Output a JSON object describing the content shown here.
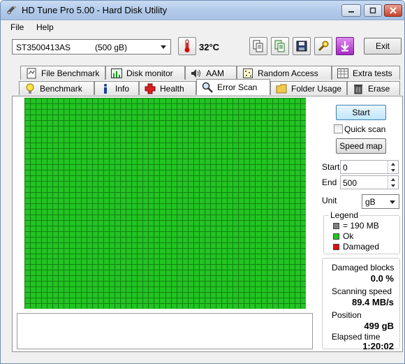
{
  "window": {
    "title": "HD Tune Pro 5.00 - Hard Disk Utility"
  },
  "menu": {
    "items": [
      "File",
      "Help"
    ]
  },
  "toolbar": {
    "drive_model": "ST3500413AS",
    "drive_capacity": "(500 gB)",
    "temperature": "32°C",
    "exit_label": "Exit",
    "icons": [
      "thermometer-icon",
      "copy-icon",
      "copy-all-icon",
      "save-icon",
      "options-icon",
      "download-icon"
    ]
  },
  "tabs": {
    "row1": [
      "File Benchmark",
      "Disk monitor",
      "AAM",
      "Random Access",
      "Extra tests"
    ],
    "row2": [
      "Benchmark",
      "Info",
      "Health",
      "Error Scan",
      "Folder Usage",
      "Erase"
    ],
    "active": "Error Scan"
  },
  "scan": {
    "grid_columns": 50,
    "grid_rows": 38,
    "block_status": "ok"
  },
  "controls": {
    "start_button": "Start",
    "quick_scan_label": "Quick scan",
    "quick_scan_checked": false,
    "speed_map_button": "Speed map",
    "start_label": "Start",
    "start_value": "0",
    "end_label": "End",
    "end_value": "500",
    "unit_label": "Unit",
    "unit_value": "gB"
  },
  "legend": {
    "title": "Legend",
    "block_size": "= 190 MB",
    "ok": "Ok",
    "damaged": "Damaged"
  },
  "stats": {
    "damaged_blocks_label": "Damaged blocks",
    "damaged_blocks_value": "0.0 %",
    "scanning_speed_label": "Scanning speed",
    "scanning_speed_value": "89.4 MB/s",
    "position_label": "Position",
    "position_value": "499 gB",
    "elapsed_label": "Elapsed time",
    "elapsed_value": "1:20:02"
  },
  "colors": {
    "ok_green": "#22c422",
    "damaged_red": "#e01010",
    "block_gray": "#808080",
    "grid_line": "#0a4a0a"
  }
}
